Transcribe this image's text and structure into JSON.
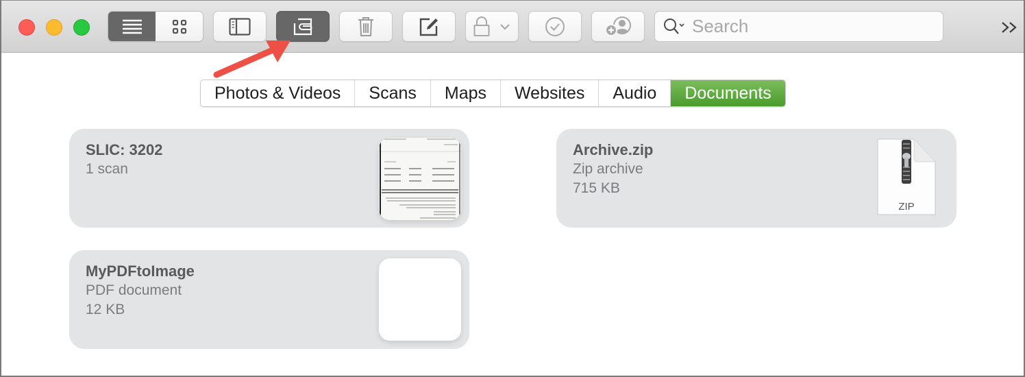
{
  "window": {
    "controls": [
      "close",
      "minimize",
      "zoom"
    ]
  },
  "toolbar": {
    "view_modes": [
      {
        "name": "list-view",
        "icon": "list-icon",
        "active": true
      },
      {
        "name": "gallery-view",
        "icon": "grid-icon",
        "active": false
      }
    ],
    "buttons": [
      {
        "name": "sidebar-toggle",
        "icon": "sidebar-icon",
        "active": false
      },
      {
        "name": "attachments-browser",
        "icon": "attachment-icon",
        "active": true
      },
      {
        "name": "delete",
        "icon": "trash-icon",
        "active": false,
        "enabled": false
      },
      {
        "name": "new-note",
        "icon": "compose-icon",
        "active": false
      },
      {
        "name": "lock",
        "icon": "lock-icon",
        "active": false,
        "enabled": false
      },
      {
        "name": "checklist",
        "icon": "checkmark-circle-icon",
        "active": false,
        "enabled": false
      },
      {
        "name": "add-people",
        "icon": "add-person-icon",
        "active": false,
        "enabled": false
      }
    ],
    "search": {
      "placeholder": "Search",
      "value": ""
    },
    "overflow_label": "»"
  },
  "annotation": {
    "type": "arrow",
    "color": "#f0524a",
    "points_to": "attachments-browser"
  },
  "tabs": [
    {
      "label": "Photos & Videos",
      "active": false
    },
    {
      "label": "Scans",
      "active": false
    },
    {
      "label": "Maps",
      "active": false
    },
    {
      "label": "Websites",
      "active": false
    },
    {
      "label": "Audio",
      "active": false
    },
    {
      "label": "Documents",
      "active": true
    }
  ],
  "colors": {
    "active_tab": "#56a336",
    "card_bg": "#e3e4e6"
  },
  "documents": [
    {
      "title": "SLIC: 3202",
      "line1": "1 scan",
      "line2": "",
      "thumbnail": "scan-preview"
    },
    {
      "title": "Archive.zip",
      "line1": "Zip archive",
      "line2": "715 KB",
      "thumbnail": "zip-icon",
      "thumb_label": "ZIP"
    },
    {
      "title": "MyPDFtoImage",
      "line1": "PDF document",
      "line2": "12 KB",
      "thumbnail": "pdf-preview"
    }
  ]
}
